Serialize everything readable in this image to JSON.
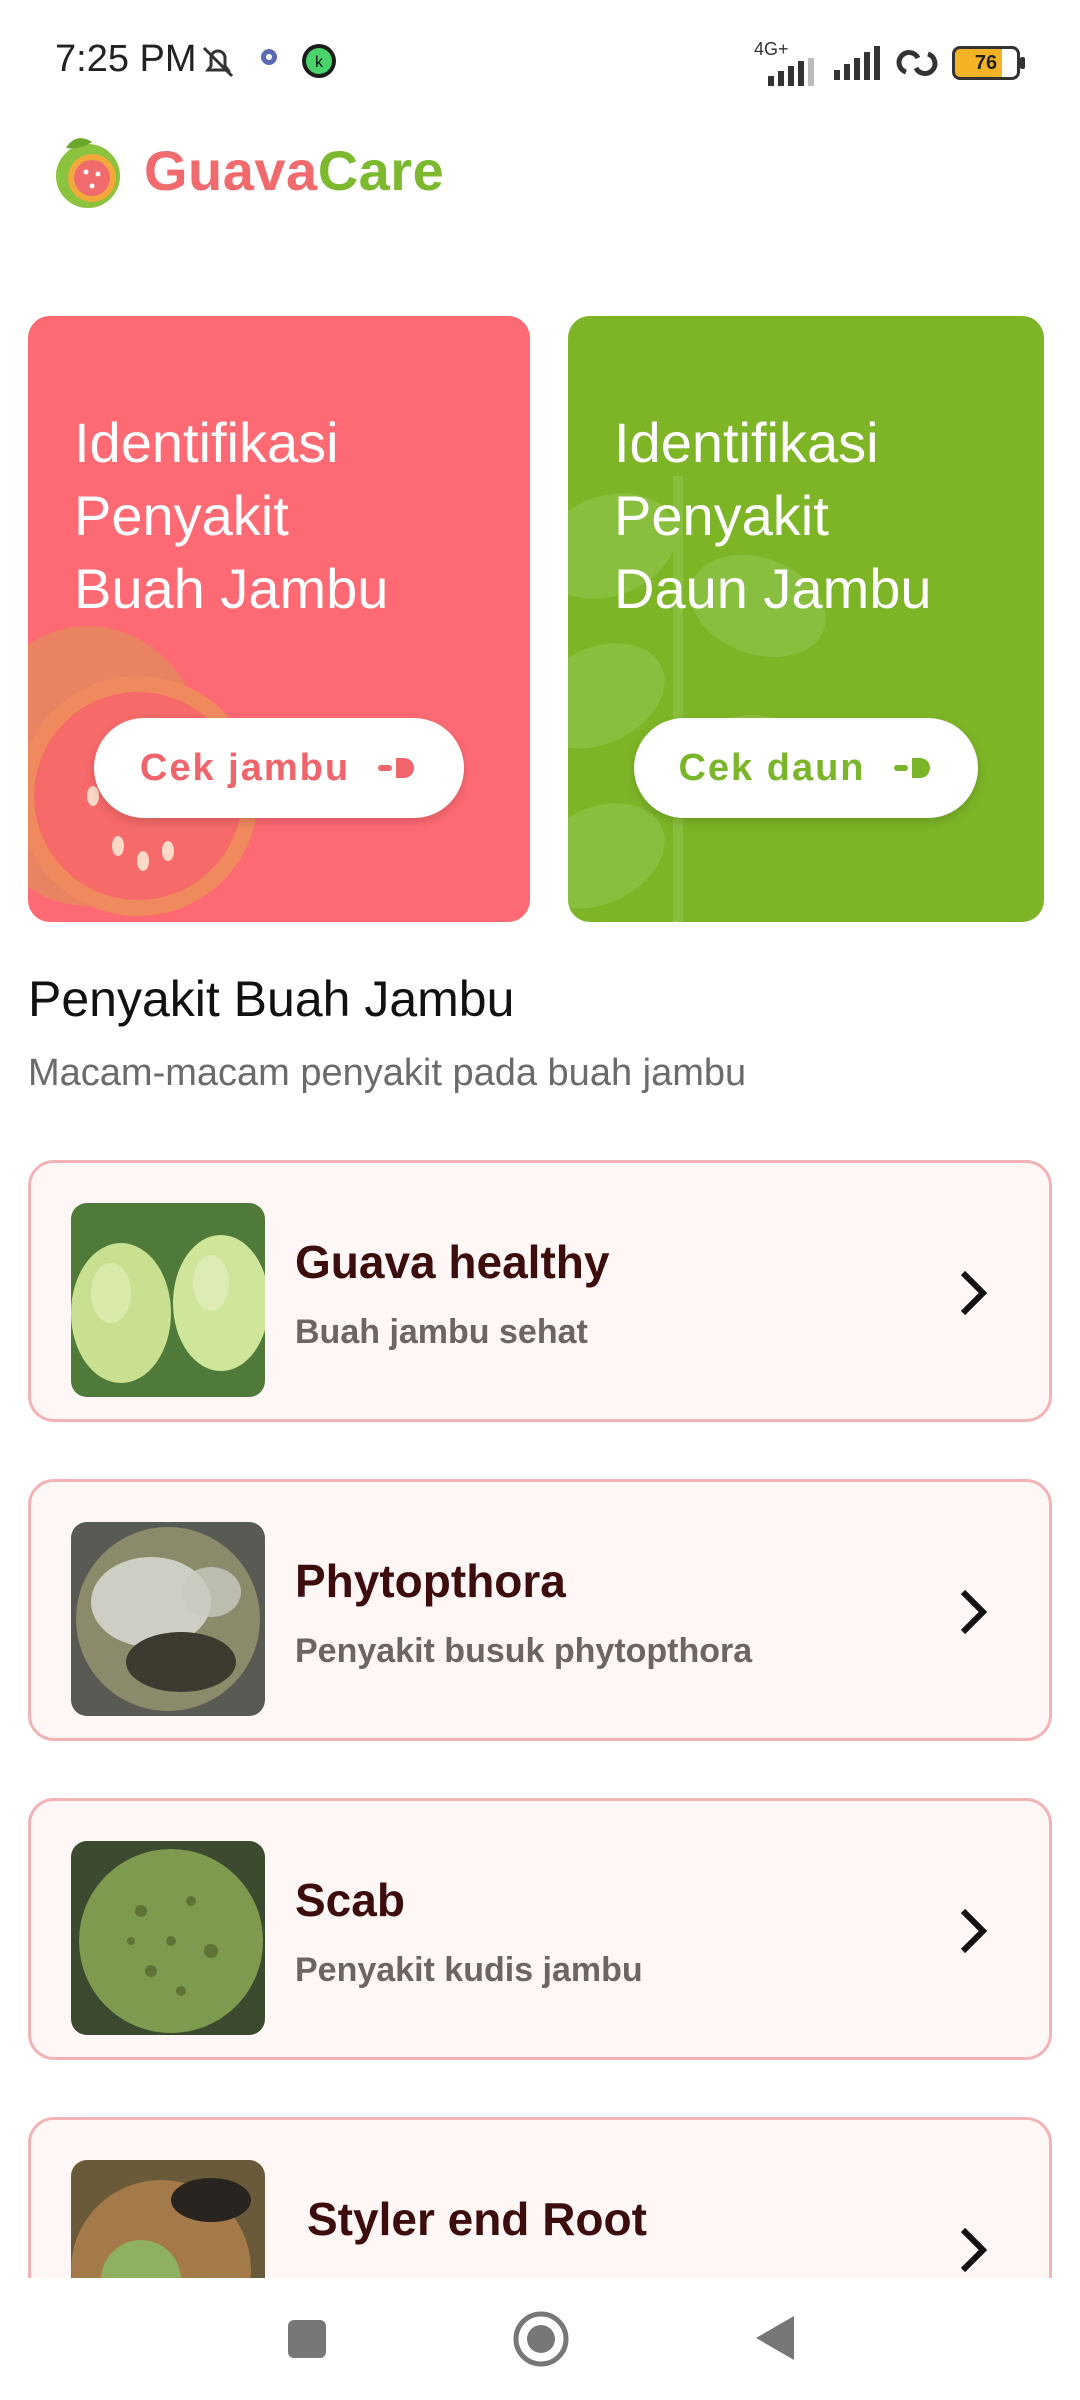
{
  "status": {
    "time": "7:25 PM",
    "network": "4G+",
    "battery": "76"
  },
  "brand": {
    "name_part1": "Guava",
    "name_part2": "Care"
  },
  "cards": {
    "fruit": {
      "title_line1": "Identifikasi",
      "title_line2": "Penyakit",
      "title_line3": "Buah Jambu",
      "button": "Cek jambu"
    },
    "leaf": {
      "title_line1": "Identifikasi",
      "title_line2": "Penyakit",
      "title_line3": "Daun Jambu",
      "button": "Cek daun"
    }
  },
  "section": {
    "title": "Penyakit Buah Jambu",
    "subtitle": "Macam-macam penyakit pada buah jambu"
  },
  "items": [
    {
      "title": "Guava healthy",
      "subtitle": "Buah jambu sehat"
    },
    {
      "title": "Phytopthora",
      "subtitle": "Penyakit busuk phytopthora"
    },
    {
      "title": "Scab",
      "subtitle": "Penyakit kudis jambu"
    },
    {
      "title": "Styler end Root",
      "subtitle": ""
    }
  ],
  "colors": {
    "fruit_card": "#fe6a73",
    "leaf_card": "#7db527",
    "brand_red": "#f06a6e",
    "brand_green": "#7cb92f",
    "item_border": "#f3b3b6"
  }
}
